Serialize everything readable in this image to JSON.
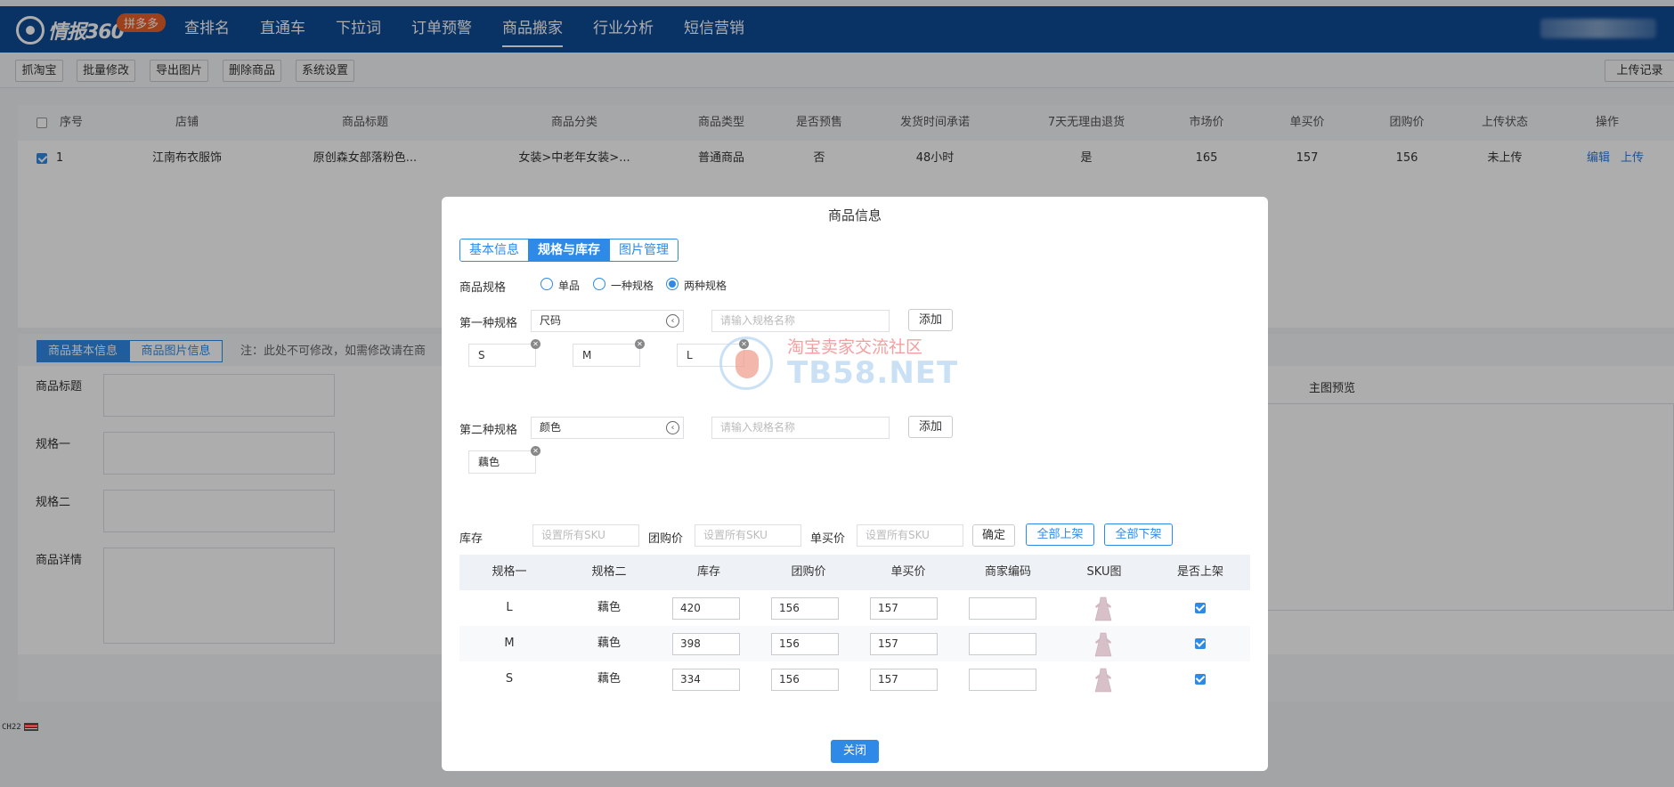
{
  "app": {
    "brand": "情报360",
    "badge": "拼多多"
  },
  "nav": [
    "查排名",
    "直通车",
    "下拉词",
    "订单预警",
    "商品搬家",
    "行业分析",
    "短信营销"
  ],
  "toolbar": {
    "buttons": [
      "抓淘宝",
      "批量修改",
      "导出图片",
      "删除商品",
      "系统设置"
    ],
    "upload_record": "上传记录"
  },
  "list": {
    "headers": [
      "序号",
      "店铺",
      "商品标题",
      "商品分类",
      "商品类型",
      "是否预售",
      "发货时间承诺",
      "7天无理由退货",
      "市场价",
      "单买价",
      "团购价",
      "上传状态",
      "操作"
    ],
    "row": {
      "index": "1",
      "shop": "江南布衣服饰",
      "title": "原创森女部落粉色...",
      "category": "女装>中老年女装>...",
      "type": "普通商品",
      "presale": "否",
      "ship_time": "48小时",
      "return7": "是",
      "market_price": "165",
      "single_price": "157",
      "group_price": "156",
      "status": "未上传",
      "action_edit": "编辑",
      "action_upload": "上传"
    }
  },
  "lower": {
    "tabs": [
      "商品基本信息",
      "商品图片信息"
    ],
    "note": "注：此处不可修改，如需修改请在商",
    "fields": [
      "商品标题",
      "规格一",
      "规格二",
      "商品详情"
    ],
    "preview_title": "主图预览"
  },
  "footer_flag": "CH22",
  "modal": {
    "title": "商品信息",
    "tabs": [
      "基本信息",
      "规格与库存",
      "图片管理"
    ],
    "spec_label": "商品规格",
    "spec_options": [
      "单品",
      "一种规格",
      "两种规格"
    ],
    "spec1": {
      "label": "第一种规格",
      "select": "尺码",
      "placeholder": "请输入规格名称",
      "add": "添加",
      "values": [
        "S",
        "M",
        "L"
      ]
    },
    "spec2": {
      "label": "第二种规格",
      "select": "颜色",
      "placeholder": "请输入规格名称",
      "add": "添加",
      "values": [
        "藕色"
      ]
    },
    "batch": {
      "stock_label": "库存",
      "group_label": "团购价",
      "single_label": "单买价",
      "placeholder": "设置所有SKU",
      "confirm": "确定",
      "all_on": "全部上架",
      "all_off": "全部下架"
    },
    "sku_headers": [
      "规格一",
      "规格二",
      "库存",
      "团购价",
      "单买价",
      "商家编码",
      "SKU图",
      "是否上架"
    ],
    "sku_rows": [
      {
        "spec1": "L",
        "spec2": "藕色",
        "stock": "420",
        "group": "156",
        "single": "157",
        "code": ""
      },
      {
        "spec1": "M",
        "spec2": "藕色",
        "stock": "398",
        "group": "156",
        "single": "157",
        "code": ""
      },
      {
        "spec1": "S",
        "spec2": "藕色",
        "stock": "334",
        "group": "156",
        "single": "157",
        "code": ""
      }
    ],
    "close": "关闭"
  },
  "watermark": {
    "line1": "淘宝卖家交流社区",
    "line2": "TB58.NET"
  },
  "colors": {
    "nav_bg": "#0e4a96",
    "accent": "#2e8ae6",
    "badge": "#e8612c"
  }
}
